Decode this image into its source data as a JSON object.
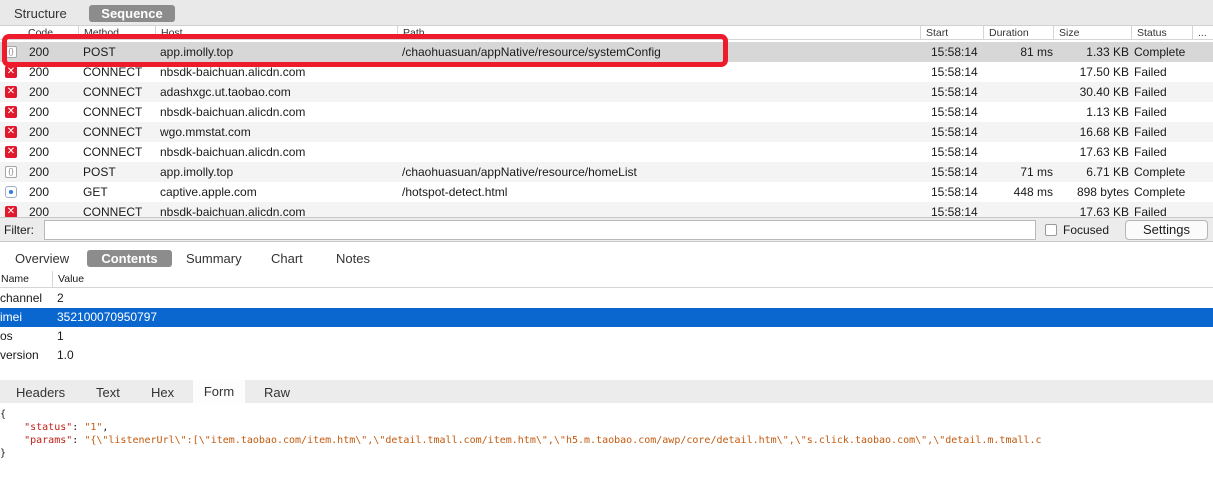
{
  "top_tabs": [
    "Structure",
    "Sequence"
  ],
  "columns": {
    "code": "Code",
    "method": "Method",
    "host": "Host",
    "path": "Path",
    "start": "Start",
    "duration": "Duration",
    "size": "Size",
    "status": "Status",
    "more": "..."
  },
  "requests": [
    {
      "icon": "json-file-icon",
      "code": "200",
      "method": "POST",
      "host": "app.imolly.top",
      "path": "/chaohuasuan/appNative/resource/systemConfig",
      "start": "15:58:14",
      "duration": "81 ms",
      "size": "1.33 KB",
      "status": "Complete"
    },
    {
      "icon": "failed-icon",
      "code": "200",
      "method": "CONNECT",
      "host": "nbsdk-baichuan.alicdn.com",
      "path": "",
      "start": "15:58:14",
      "duration": "",
      "size": "17.50 KB",
      "status": "Failed"
    },
    {
      "icon": "failed-icon",
      "code": "200",
      "method": "CONNECT",
      "host": "adashxgc.ut.taobao.com",
      "path": "",
      "start": "15:58:14",
      "duration": "",
      "size": "30.40 KB",
      "status": "Failed"
    },
    {
      "icon": "failed-icon",
      "code": "200",
      "method": "CONNECT",
      "host": "nbsdk-baichuan.alicdn.com",
      "path": "",
      "start": "15:58:14",
      "duration": "",
      "size": "1.13 KB",
      "status": "Failed"
    },
    {
      "icon": "failed-icon",
      "code": "200",
      "method": "CONNECT",
      "host": "wgo.mmstat.com",
      "path": "",
      "start": "15:58:14",
      "duration": "",
      "size": "16.68 KB",
      "status": "Failed"
    },
    {
      "icon": "failed-icon",
      "code": "200",
      "method": "CONNECT",
      "host": "nbsdk-baichuan.alicdn.com",
      "path": "",
      "start": "15:58:14",
      "duration": "",
      "size": "17.63 KB",
      "status": "Failed"
    },
    {
      "icon": "json-file-icon",
      "code": "200",
      "method": "POST",
      "host": "app.imolly.top",
      "path": "/chaohuasuan/appNative/resource/homeList",
      "start": "15:58:14",
      "duration": "71 ms",
      "size": "6.71 KB",
      "status": "Complete"
    },
    {
      "icon": "web-icon",
      "code": "200",
      "method": "GET",
      "host": "captive.apple.com",
      "path": "/hotspot-detect.html",
      "start": "15:58:14",
      "duration": "448 ms",
      "size": "898 bytes",
      "status": "Complete"
    },
    {
      "icon": "failed-icon",
      "code": "200",
      "method": "CONNECT",
      "host": "nbsdk-baichuan.alicdn.com",
      "path": "",
      "start": "15:58:14",
      "duration": "",
      "size": "17.63 KB",
      "status": "Failed"
    }
  ],
  "filter": {
    "label": "Filter:",
    "value": "",
    "focused_label": "Focused",
    "settings_label": "Settings"
  },
  "detail_tabs": [
    "Overview",
    "Contents",
    "Summary",
    "Chart",
    "Notes"
  ],
  "form": {
    "name_header": "Name",
    "value_header": "Value",
    "rows": [
      {
        "name": "channel",
        "value": "2"
      },
      {
        "name": "imei",
        "value": "352100070950797"
      },
      {
        "name": "os",
        "value": "1"
      },
      {
        "name": "version",
        "value": "1.0"
      }
    ]
  },
  "content_tabs": [
    "Headers",
    "Text",
    "Hex",
    "Form",
    "Raw"
  ],
  "raw": {
    "open": "{",
    "status_key": "\"status\"",
    "status_value": "\"1\"",
    "params_key": "\"params\"",
    "params_value": "\"{\\\"listenerUrl\\\":[\\\"item.taobao.com/item.htm\\\",\\\"detail.tmall.com/item.htm\\\",\\\"h5.m.taobao.com/awp/core/detail.htm\\\",\\\"s.click.taobao.com\\\",\\\"detail.m.tmall.c",
    "close": "}"
  },
  "colors": {
    "failed": "#e0192d",
    "selection": "#0a67d0",
    "highlight": "#ee1b2d"
  }
}
